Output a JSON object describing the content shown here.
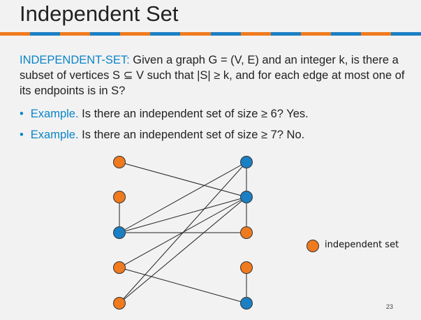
{
  "slide": {
    "title": "Independent Set",
    "definition": {
      "term": "INDEPENDENT-SET:",
      "text": " Given a graph G = (V, E) and an integer k, is there a subset of vertices S ⊆ V such that |S| ≥ k, and for each edge at most one of its endpoints is in S?"
    },
    "bullets": [
      {
        "label": "Example.",
        "text": " Is there an independent set of size ≥ 6?  Yes."
      },
      {
        "label": "Example.",
        "text": " Is there an independent set of size ≥ 7?  No."
      }
    ],
    "legend_label": "independent set",
    "page_number": "23"
  },
  "colors": {
    "accent": "#0a84c8",
    "orange": "#f07a1e",
    "blue": "#1b7fc4",
    "stripe": [
      "#f07a1e",
      "#1b7fc4"
    ]
  },
  "graph": {
    "nodes": [
      {
        "id": "L1",
        "in_set": true
      },
      {
        "id": "L2",
        "in_set": true
      },
      {
        "id": "L3",
        "in_set": false
      },
      {
        "id": "L4",
        "in_set": true
      },
      {
        "id": "L5",
        "in_set": true
      },
      {
        "id": "R1",
        "in_set": false
      },
      {
        "id": "R2",
        "in_set": false
      },
      {
        "id": "R3",
        "in_set": true
      },
      {
        "id": "R4",
        "in_set": true
      },
      {
        "id": "R5",
        "in_set": false
      }
    ],
    "edges": [
      [
        "L1",
        "R2"
      ],
      [
        "L2",
        "L3"
      ],
      [
        "L3",
        "R1"
      ],
      [
        "L3",
        "R2"
      ],
      [
        "L3",
        "R3"
      ],
      [
        "L4",
        "R2"
      ],
      [
        "L4",
        "R5"
      ],
      [
        "L5",
        "R1"
      ],
      [
        "L5",
        "R2"
      ],
      [
        "R1",
        "R2"
      ],
      [
        "R2",
        "R3"
      ],
      [
        "R4",
        "R5"
      ]
    ]
  }
}
